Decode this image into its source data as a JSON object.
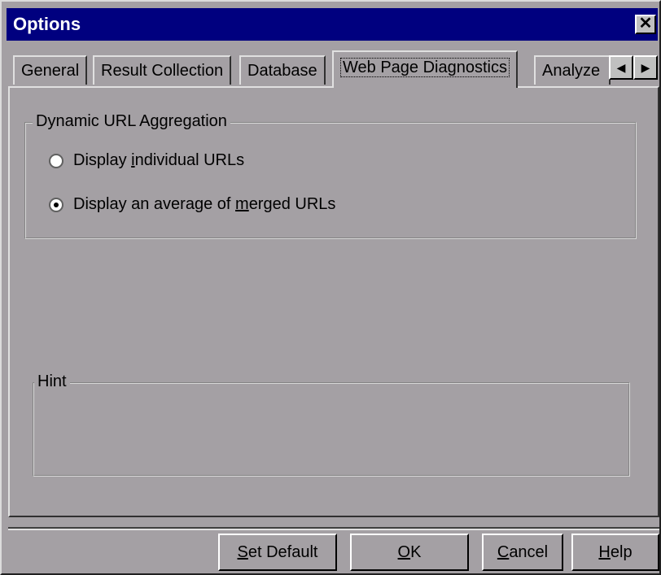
{
  "window": {
    "title": "Options",
    "close_glyph": "✕"
  },
  "tabs": [
    {
      "label": "General"
    },
    {
      "label": "Result Collection"
    },
    {
      "label": "Database"
    },
    {
      "label": "Web Page Diagnostics",
      "active": true
    },
    {
      "label": "Analyze"
    }
  ],
  "tab_scroll": {
    "left_glyph": "◀",
    "right_glyph": "▶"
  },
  "aggregation": {
    "legend": "Dynamic URL Aggregation",
    "options": [
      {
        "pre": "Display ",
        "ul": "i",
        "post": "ndividual URLs",
        "checked": false
      },
      {
        "pre": "Display an average of ",
        "ul": "m",
        "post": "erged URLs",
        "checked": true
      }
    ]
  },
  "hint": {
    "legend": "Hint"
  },
  "buttons": {
    "set_default": {
      "ul": "S",
      "rest": "et Default"
    },
    "ok": {
      "ul": "O",
      "rest": "K"
    },
    "cancel": {
      "ul": "C",
      "rest": "ancel"
    },
    "help": {
      "ul": "H",
      "rest": "elp"
    }
  },
  "colors": {
    "titlebar": "#00007f",
    "face": "#a4a0a4"
  }
}
